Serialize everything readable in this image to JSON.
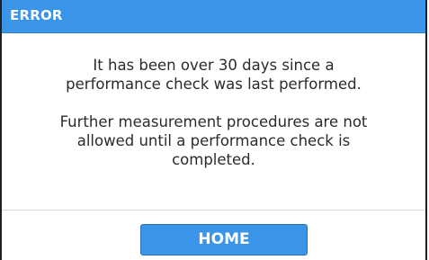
{
  "dialog": {
    "title": "ERROR",
    "message": {
      "paragraph1": [
        "It has been over 30 days since a",
        "performance check was last performed."
      ],
      "paragraph2": [
        "Further measurement procedures are not",
        "allowed until a performance check is",
        "completed."
      ]
    },
    "buttons": {
      "home_label": "HOME"
    }
  },
  "colors": {
    "titlebar": "#3a95e8",
    "button": "#3a95e8",
    "text": "#2b2b2b",
    "border": "#1f1f1f"
  }
}
